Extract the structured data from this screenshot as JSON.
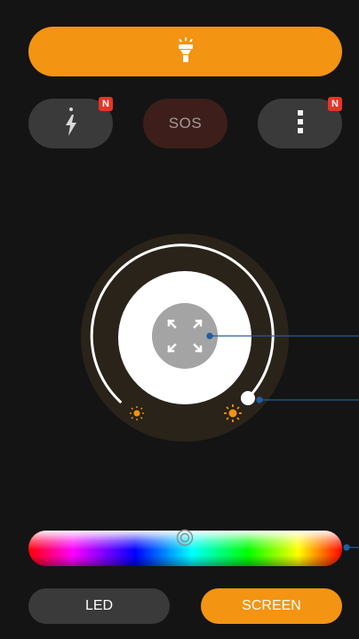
{
  "top_button": {
    "icon": "flashlight-icon",
    "color": "#f39412"
  },
  "pills": [
    {
      "icon": "flash-icon",
      "badge": "N"
    },
    {
      "label": "SOS"
    },
    {
      "icon": "more-vertical-icon",
      "badge": "N"
    }
  ],
  "dial": {
    "center_icon": "expand-icon",
    "brightness_low_icon": "brightness-low-icon",
    "brightness_high_icon": "brightness-high-icon",
    "level": 0.88
  },
  "color_slider": {
    "thumb_icon": "ring-thumb-icon",
    "position": 0.5
  },
  "modes": {
    "led_label": "LED",
    "screen_label": "SCREEN",
    "selected": "SCREEN"
  },
  "colors": {
    "background": "#141414",
    "accent": "#f39412",
    "pill": "#3a3a3a",
    "sos": "#3e1e1a",
    "badge": "#e53526",
    "annotation": "#1f5f9e"
  }
}
